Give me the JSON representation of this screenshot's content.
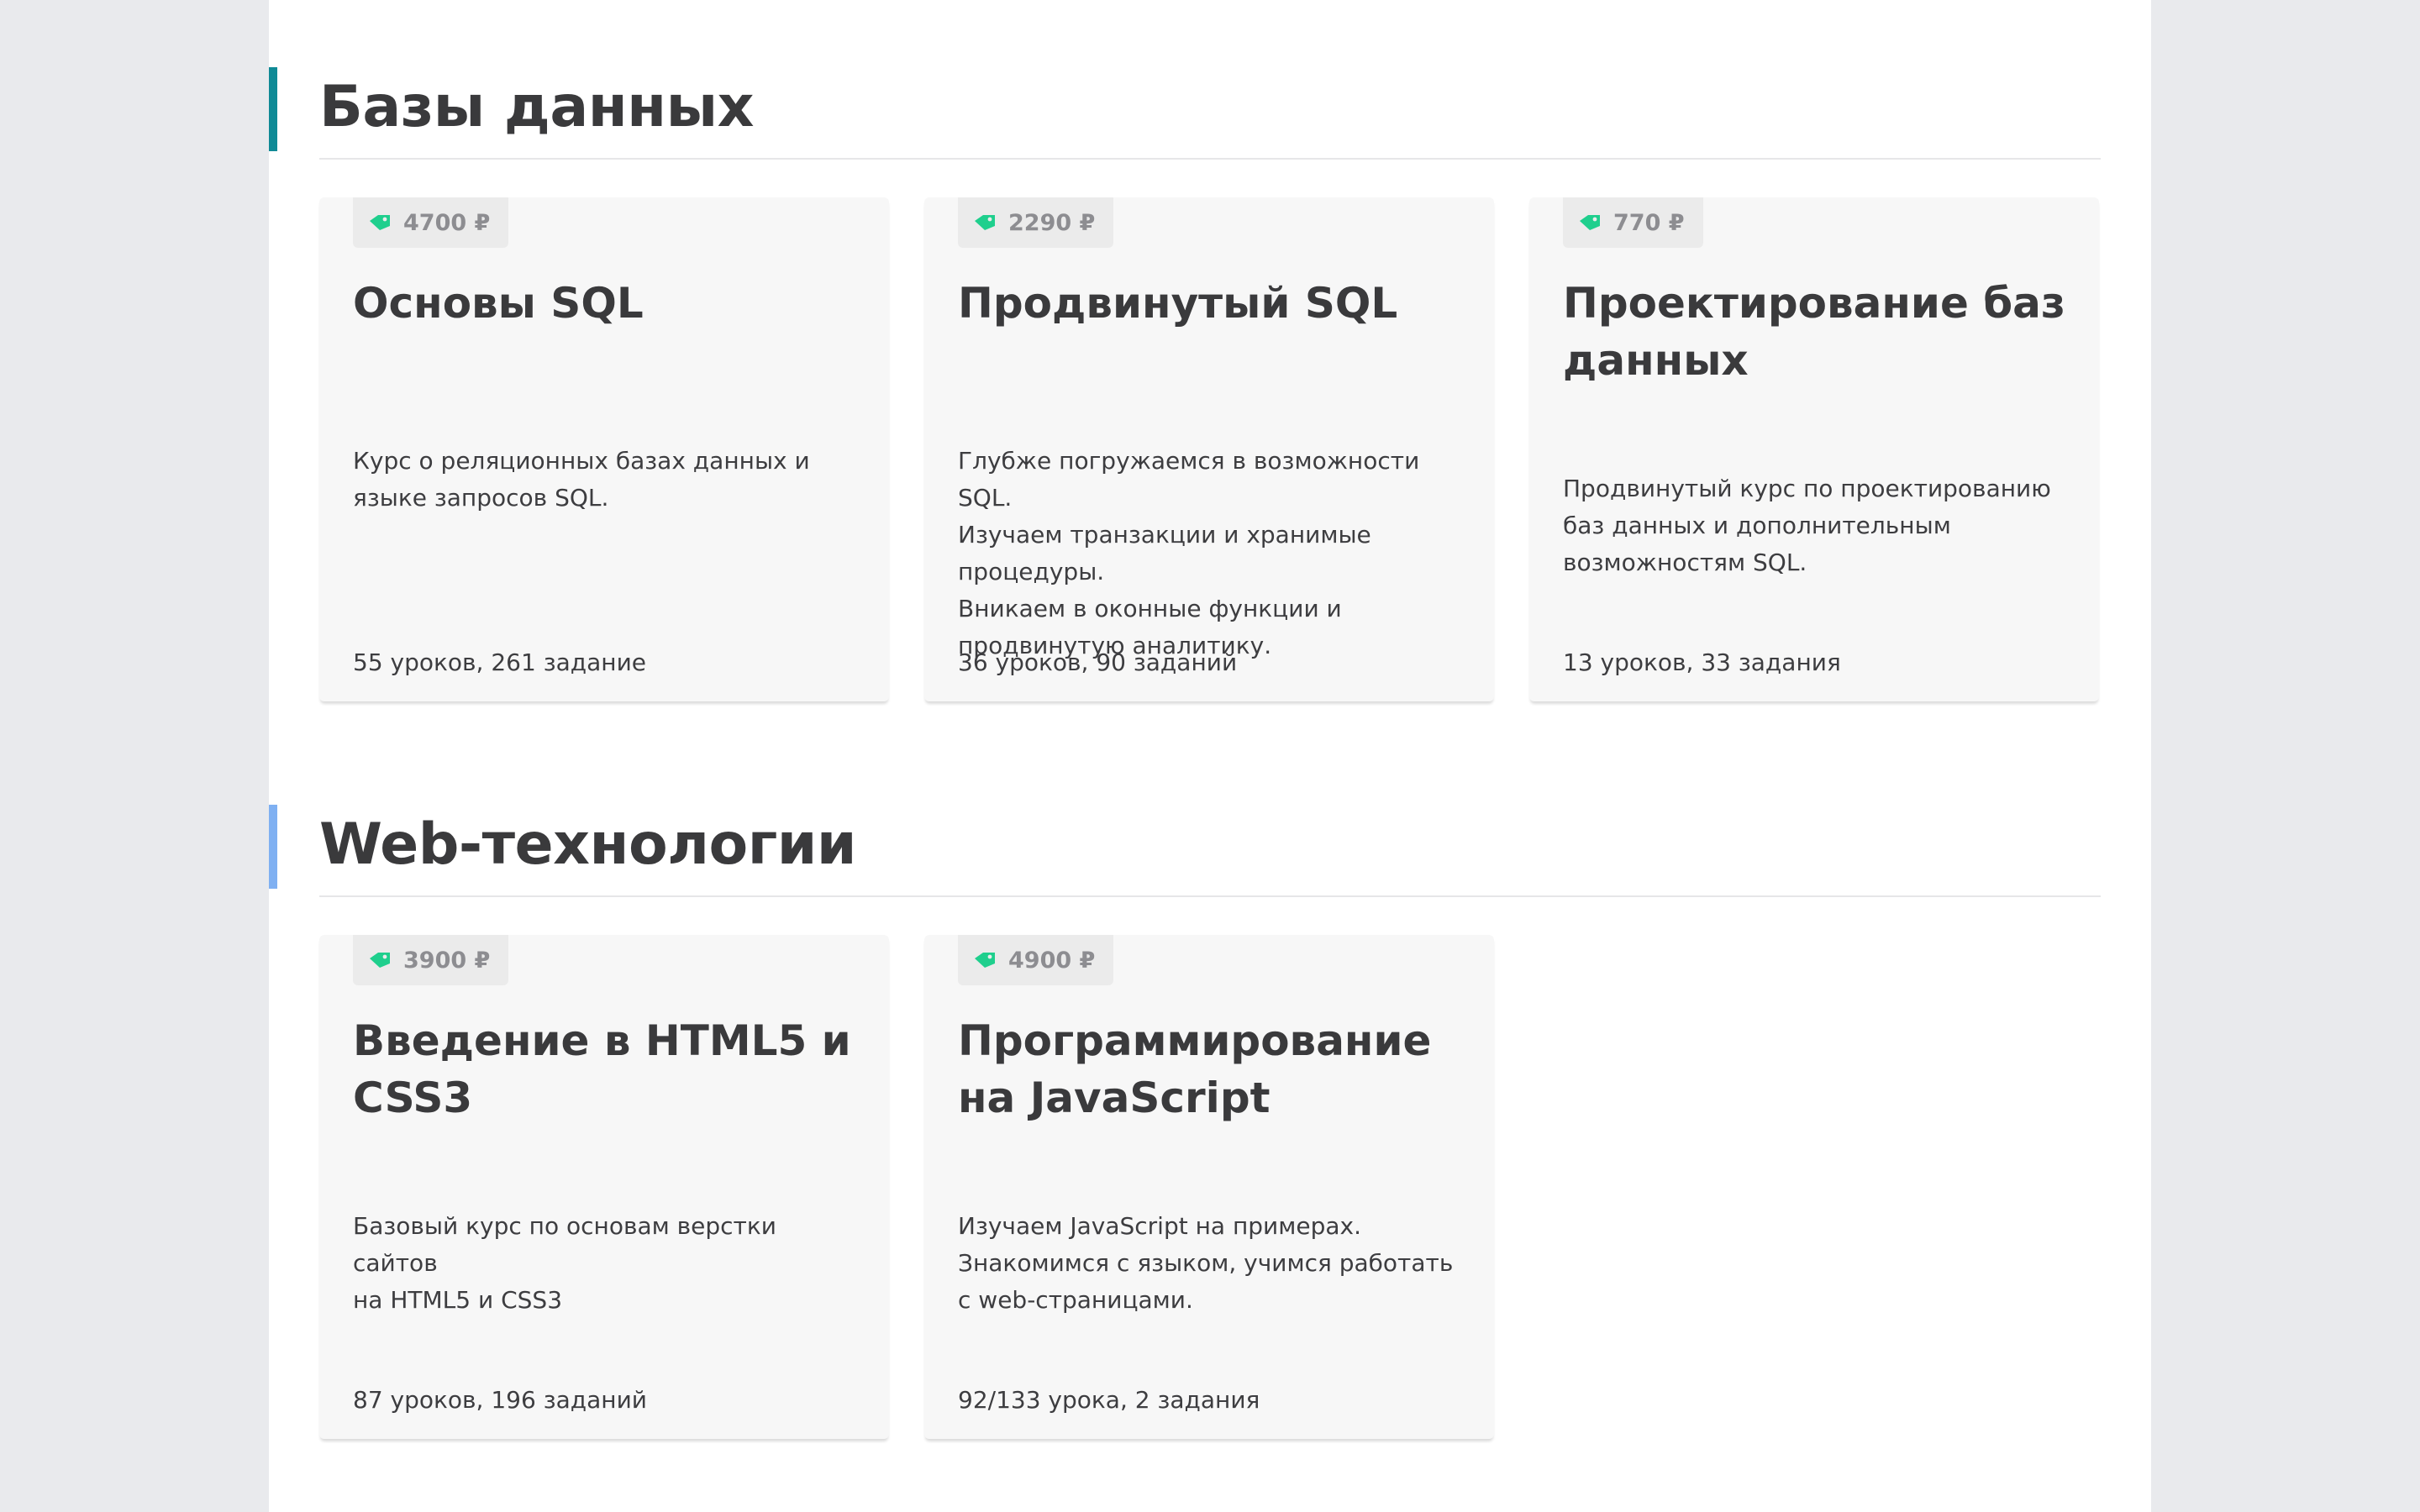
{
  "sections": [
    {
      "title": "Базы данных",
      "accent": "#0f8a96",
      "courses": [
        {
          "price": "4700 ₽",
          "title": "Основы SQL",
          "description": "Курс о реляционных базах данных и\nязыке запросов SQL.",
          "stats": "55 уроков, 261 задание"
        },
        {
          "price": "2290 ₽",
          "title": "Продвинутый SQL",
          "description": "Глубже погружаемся в возможности SQL.\nИзучаем транзакции и хранимые\nпроцедуры.\nВникаем в оконные функции и\nпродвинутую аналитику.",
          "stats": "36 уроков, 90 заданий"
        },
        {
          "price": "770 ₽",
          "title": "Проектирование баз данных",
          "description": "Продвинутый курс по проектированию\nбаз данных и дополнительным\nвозможностям SQL.",
          "stats": "13 уроков, 33 задания"
        }
      ]
    },
    {
      "title": "Web-технологии",
      "accent": "#7fb0f2",
      "courses": [
        {
          "price": "3900 ₽",
          "title": "Введение в HTML5 и CSS3",
          "description": "Базовый курс по основам верстки сайтов\nна HTML5 и CSS3",
          "stats": "87 уроков, 196 заданий"
        },
        {
          "price": "4900 ₽",
          "title": "Программирование на JavaScript",
          "description": "Изучаем JavaScript на примерах.\nЗнакомимся с языком, учимся работать\nс web-страницами.",
          "stats": "92/133 урока, 2 задания"
        }
      ]
    }
  ],
  "colors": {
    "price_tag_icon": "#1fcf8d",
    "background": "#e9eaed",
    "page": "#ffffff",
    "card": "#f7f7f7"
  },
  "icons": {
    "price": "price-tag-icon"
  }
}
